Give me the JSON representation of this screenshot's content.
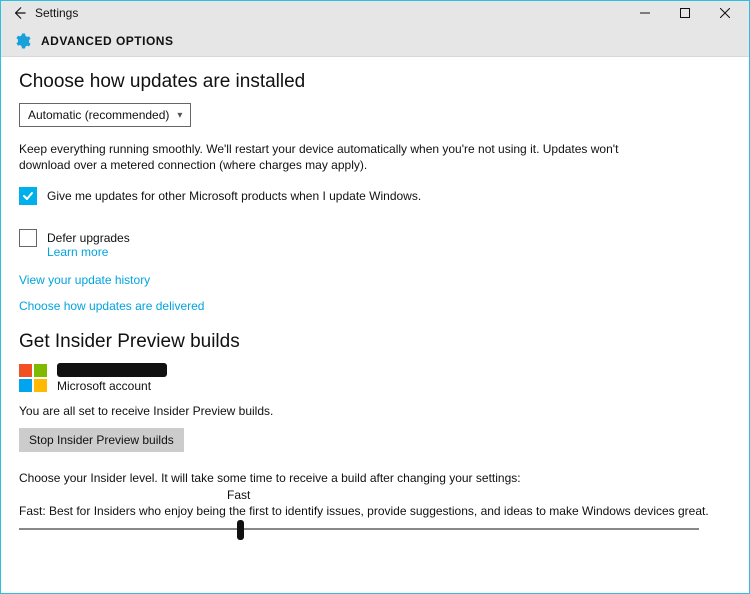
{
  "window": {
    "title": "Settings"
  },
  "ribbon": {
    "title": "ADVANCED OPTIONS"
  },
  "updates": {
    "heading": "Choose how updates are installed",
    "dropdown_value": "Automatic (recommended)",
    "description": "Keep everything running smoothly. We'll restart your device automatically when you're not using it. Updates won't download over a metered connection (where charges may apply).",
    "checkbox_other_products": "Give me updates for other Microsoft products when I update Windows.",
    "checkbox_defer": "Defer upgrades",
    "learn_more": "Learn more",
    "link_history": "View your update history",
    "link_delivered": "Choose how updates are delivered"
  },
  "insider": {
    "heading": "Get Insider Preview builds",
    "account_type": "Microsoft account",
    "ready_text": "You are all set to receive Insider Preview builds.",
    "stop_button": "Stop Insider Preview builds",
    "level_intro": "Choose your Insider level. It will take some time to receive a build after changing your settings:",
    "slider_label": "Fast",
    "slider_desc": "Fast: Best for Insiders who enjoy being the first to identify issues, provide suggestions, and ideas to make Windows devices great."
  }
}
